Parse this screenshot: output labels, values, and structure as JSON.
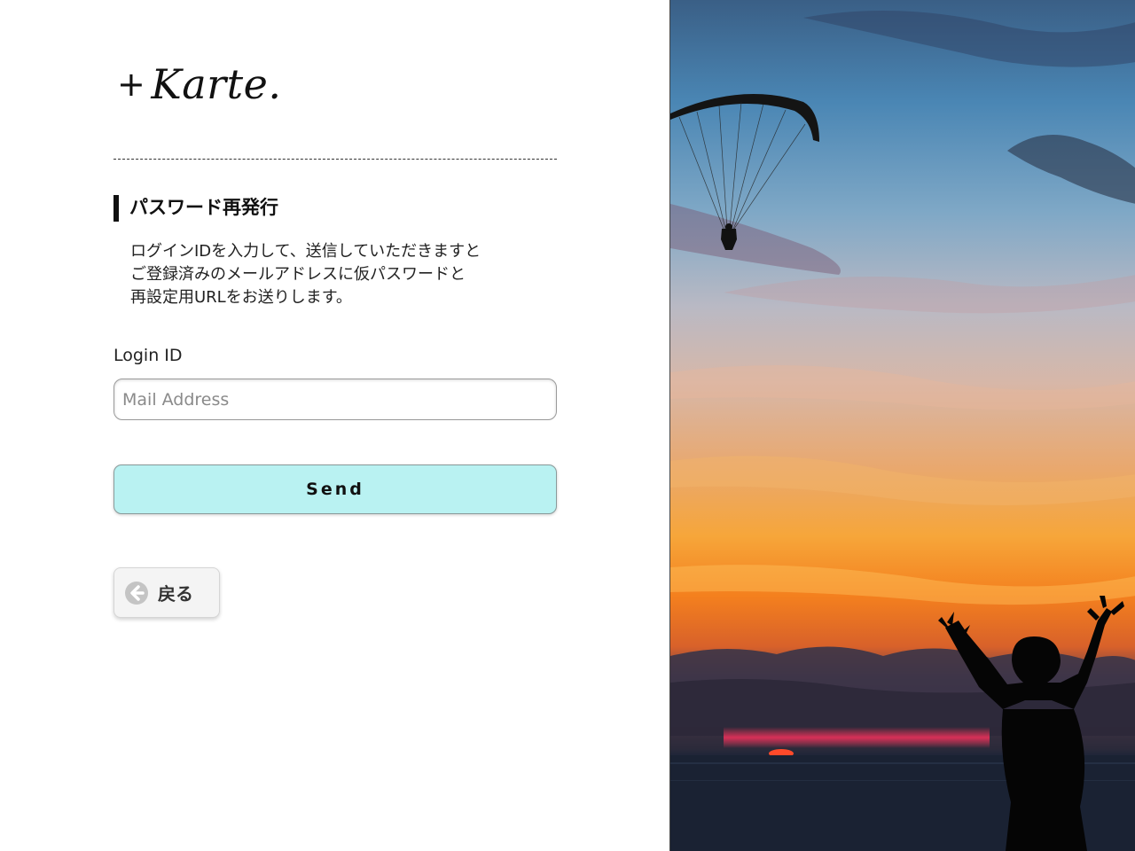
{
  "brand": {
    "logo_text": "Karte.",
    "logo_prefix": "+"
  },
  "section": {
    "title": "パスワード再発行",
    "description_lines": [
      "ログインIDを入力して、送信していただきますと",
      "ご登録済みのメールアドレスに仮パスワードと",
      "再設定用URLをお送りします。"
    ]
  },
  "form": {
    "login_label": "Login ID",
    "mail_placeholder": "Mail Address",
    "mail_value": "",
    "send_label": "Send"
  },
  "back": {
    "label": "戻る",
    "icon": "arrow-left-circle-icon"
  },
  "hero": {
    "description": "sunset-paraglider-photo",
    "colors": {
      "sky_top": "#3f6f9a",
      "sky_mid": "#9fb6c6",
      "horizon_orange": "#f7a12a",
      "sea": "#1a2538"
    }
  }
}
